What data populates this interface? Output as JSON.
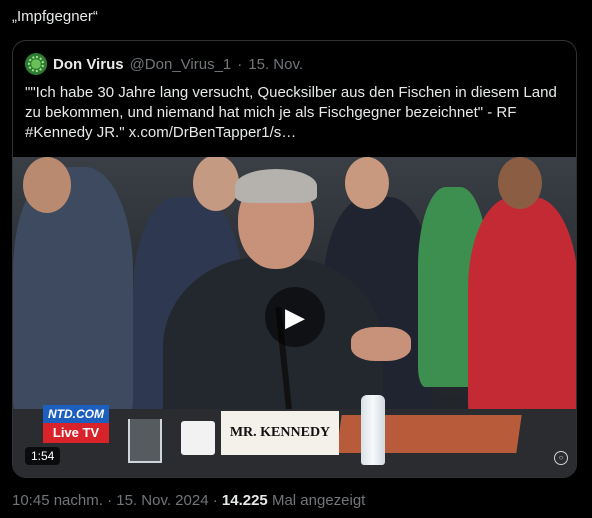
{
  "tweet": {
    "text": "„Impfgegner“"
  },
  "quote": {
    "display_name": "Don Virus",
    "handle": "@Don_Virus_1",
    "separator": "·",
    "date": "15. Nov.",
    "body_text": "\"\"Ich habe 30 Jahre lang versucht, Quecksilber aus den Fischen in diesem Land zu bekommen, und niemand hat mich je als Fischgegner bezeichnet\" - RF #Kennedy JR.\"",
    "link": "x.com/DrBenTapper1/s…",
    "avatar_icon": "virus-avatar-icon"
  },
  "video": {
    "nameplate": "MR. KENNEDY",
    "channel_top": "NTD.COM",
    "channel_bottom": "Live TV",
    "duration": "1:54",
    "play_icon": "play-icon",
    "accent_blue": "#1d5fbf",
    "accent_red": "#d8232a"
  },
  "meta": {
    "time": "10:45 nachm.",
    "separator": "·",
    "date": "15. Nov. 2024",
    "views": "14.225",
    "views_label": "Mal angezeigt"
  }
}
